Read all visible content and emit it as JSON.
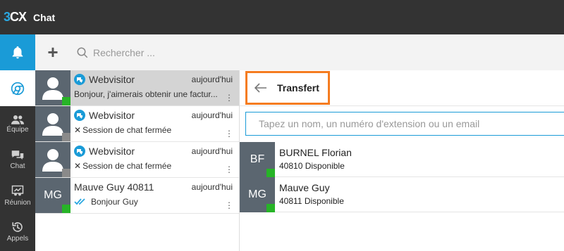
{
  "app": {
    "logo": "3CX",
    "title": "Chat"
  },
  "sidebar": {
    "items": [
      {
        "label": "",
        "icon": "bell-icon"
      },
      {
        "label": "",
        "icon": "chrome-icon"
      },
      {
        "label": "Équipe",
        "icon": "team-icon"
      },
      {
        "label": "Chat",
        "icon": "chat-icon"
      },
      {
        "label": "Réunion",
        "icon": "meeting-icon"
      },
      {
        "label": "Appels",
        "icon": "history-icon"
      }
    ]
  },
  "toolbar": {
    "add_label": "+",
    "search_placeholder": "Rechercher ..."
  },
  "conversations": [
    {
      "avatar": "",
      "name": "Webvisitor",
      "time": "aujourd'hui",
      "message": "Bonjour, j'aimerais obtenir une factur...",
      "status_color": "#27b427",
      "webvisitor": true,
      "closed": false
    },
    {
      "avatar": "",
      "name": "Webvisitor",
      "time": "aujourd'hui",
      "message": "Session de chat fermée",
      "status_color": "#8a8a8a",
      "webvisitor": true,
      "closed": true
    },
    {
      "avatar": "",
      "name": "Webvisitor",
      "time": "aujourd'hui",
      "message": "Session de chat fermée",
      "status_color": "#8a8a8a",
      "webvisitor": true,
      "closed": true
    },
    {
      "avatar": "MG",
      "name": "Mauve Guy 40811",
      "time": "aujourd'hui",
      "message": "Bonjour Guy",
      "status_color": "#27b427",
      "webvisitor": false,
      "closed": false
    }
  ],
  "panel": {
    "title": "Transfert",
    "input_placeholder": "Tapez un nom, un numéro d'extension ou un email",
    "contacts": [
      {
        "initials": "BF",
        "name": "BURNEL Florian",
        "ext": "40810",
        "status": "Disponible"
      },
      {
        "initials": "MG",
        "name": "Mauve Guy",
        "ext": "40811",
        "status": "Disponible"
      }
    ]
  },
  "colors": {
    "accent": "#1a9bd7",
    "highlight": "#f57c20",
    "available": "#27b427",
    "offline": "#8a8a8a"
  }
}
